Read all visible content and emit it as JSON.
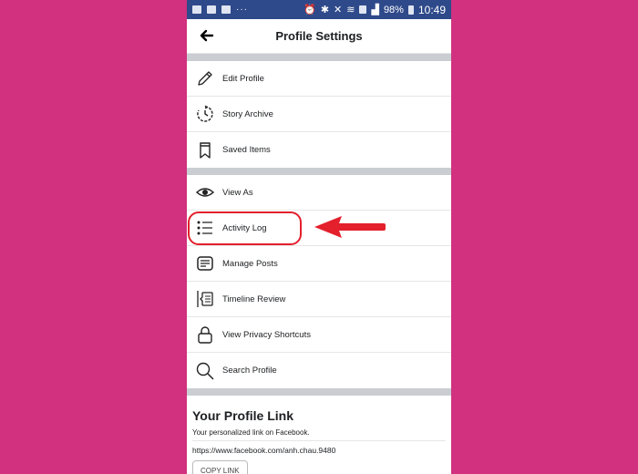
{
  "status_bar": {
    "battery": "98%",
    "time": "10:49",
    "left_icons": [
      "image-icon",
      "message-icon",
      "mail-icon",
      "more-icon"
    ],
    "right_icons": [
      "alarm-icon",
      "bluetooth-icon",
      "mute-icon",
      "wifi-icon",
      "sim-icon",
      "signal-icon",
      "battery-icon"
    ]
  },
  "header": {
    "title": "Profile Settings",
    "back_icon": "arrow-left-icon"
  },
  "groups": [
    [
      {
        "label": "Edit Profile",
        "icon": "pencil-icon"
      },
      {
        "label": "Story Archive",
        "icon": "clock-history-icon"
      },
      {
        "label": "Saved Items",
        "icon": "bookmark-icon"
      }
    ],
    [
      {
        "label": "View As",
        "icon": "eye-icon"
      },
      {
        "label": "Activity Log",
        "icon": "list-icon",
        "highlighted": true
      },
      {
        "label": "Manage Posts",
        "icon": "posts-icon"
      },
      {
        "label": "Timeline Review",
        "icon": "timeline-icon"
      },
      {
        "label": "View Privacy Shortcuts",
        "icon": "lock-icon"
      },
      {
        "label": "Search Profile",
        "icon": "search-icon"
      }
    ]
  ],
  "profile_link": {
    "title": "Your Profile Link",
    "subtitle": "Your personalized link on Facebook.",
    "url": "https://www.facebook.com/anh.chau.9480",
    "copy_label": "COPY LINK"
  },
  "annotation": {
    "color": "#e3202c",
    "target": "Activity Log"
  },
  "colors": {
    "background": "#d1317f",
    "status_bar": "#2f4a8a",
    "separator": "#cacdd2"
  }
}
